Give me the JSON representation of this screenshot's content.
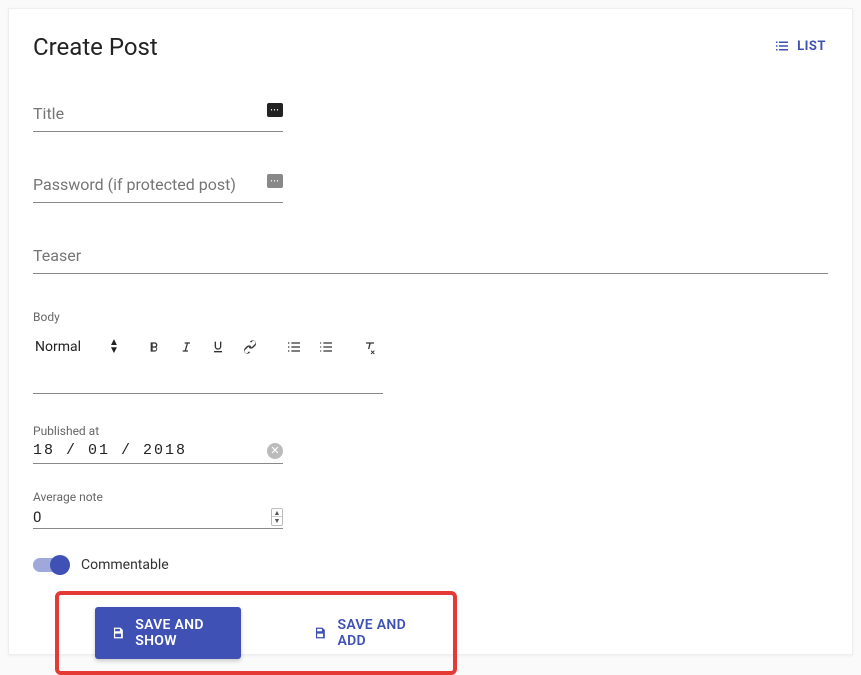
{
  "header": {
    "page_title": "Create Post",
    "list_button": "LIST"
  },
  "fields": {
    "title_label": "Title",
    "password_label": "Password (if protected post)",
    "teaser_label": "Teaser",
    "body_label": "Body",
    "body_format": "Normal",
    "published_label": "Published at",
    "published_value": "18 / 01 / 2018",
    "avg_label": "Average note",
    "avg_value": "0",
    "commentable_label": "Commentable",
    "commentable_on": true
  },
  "buttons": {
    "save_show": "SAVE AND SHOW",
    "save_add": "SAVE AND ADD"
  }
}
